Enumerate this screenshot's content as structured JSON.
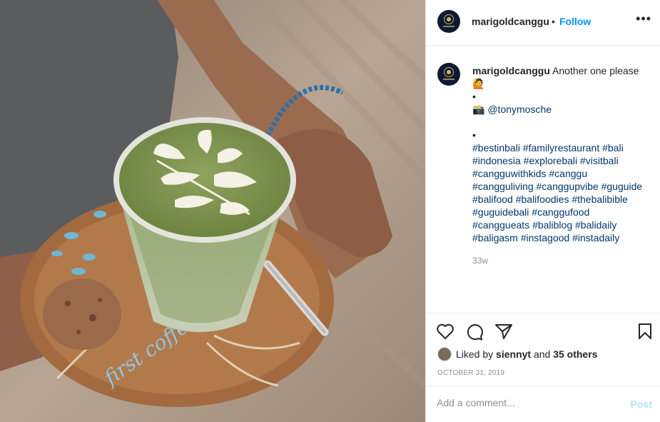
{
  "post": {
    "username": "marigoldcanggu",
    "separator": "•",
    "follow_label": "Follow",
    "more_label": "•••",
    "caption": {
      "text": "Another one please",
      "emoji1": "🙋",
      "bullet1": "•",
      "photo_credit": "📸 @tonymosche",
      "bullet2": "•",
      "hashtag_lines": [
        "#bestinbali #familyrestaurant #bali",
        "#indonesia #explorebali #visitbali",
        "#cangguwithkids #canggu",
        "#cangguliving #canggupvibe #guguide",
        "#balifood #balifoodies #thebalibible",
        "#guguidebali #canggufood",
        "#canggueats #baliblog #balidaily",
        "#baligasm #instagood #instadaily"
      ],
      "time_ago": "33w"
    },
    "likes": {
      "prefix": "Liked by",
      "user": "siennyt",
      "and": "and",
      "others": "35 others"
    },
    "date": "OCTOBER 31, 2019",
    "comment": {
      "placeholder": "Add a comment...",
      "post_label": "Post"
    }
  },
  "icons": [
    "heart-icon",
    "comment-icon",
    "share-icon",
    "bookmark-icon"
  ],
  "colors": {
    "follow": "#0095f6",
    "hashtag": "#00376b",
    "muted": "#8e8e8e",
    "post_disabled": "#b2dffc"
  }
}
